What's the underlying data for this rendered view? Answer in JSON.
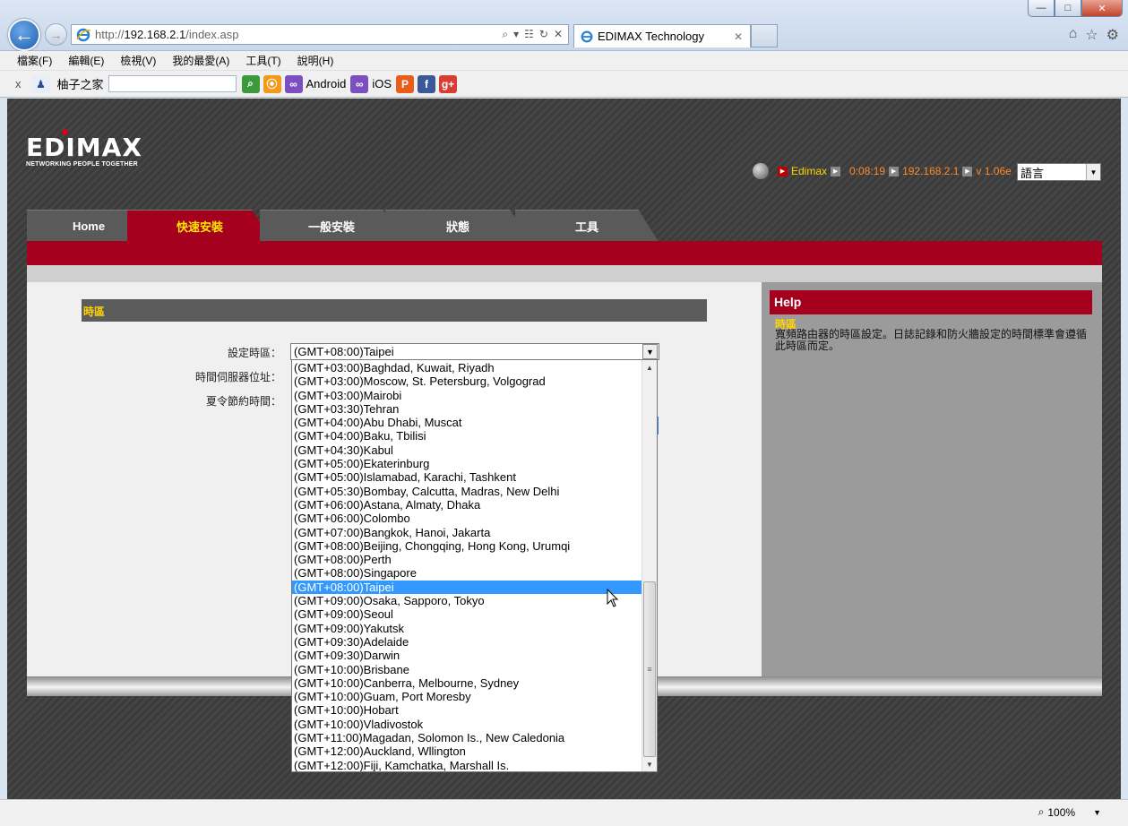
{
  "browser": {
    "url_prefix": "http://",
    "url_host": "192.168.2.1",
    "url_path": "/index.asp",
    "tab_title": "EDIMAX Technology",
    "menu": [
      "檔案(F)",
      "編輯(E)",
      "檢視(V)",
      "我的最愛(A)",
      "工具(T)",
      "說明(H)"
    ],
    "favorites": {
      "site_name": "柚子之家",
      "android_label": "Android",
      "ios_label": "iOS"
    },
    "zoom": "100%"
  },
  "router": {
    "logo": "EDIMAX",
    "logo_tagline": "NETWORKING PEOPLE TOGETHER",
    "status": {
      "name": "Edimax",
      "uptime": "0:08:19",
      "ip": "192.168.2.1",
      "version": "v 1.06e"
    },
    "language_select": "語言",
    "nav_tabs": [
      "Home",
      "快速安裝",
      "一般安裝",
      "狀態",
      "工具"
    ],
    "section_title": "時區",
    "form": {
      "timezone_label": "設定時區：",
      "ntp_label": "時間伺服器位址：",
      "dst_label": "夏令節約時間：",
      "timezone_value": "(GMT+08:00)Taipei"
    },
    "help": {
      "header": "Help",
      "title": "時區",
      "text": "寬頻路由器的時區設定。日誌記錄和防火牆設定的時間標準會遵循此時區而定。"
    },
    "timezone_options": [
      "(GMT+03:00)Baghdad, Kuwait, Riyadh",
      "(GMT+03:00)Moscow, St. Petersburg, Volgograd",
      "(GMT+03:00)Mairobi",
      "(GMT+03:30)Tehran",
      "(GMT+04:00)Abu Dhabi, Muscat",
      "(GMT+04:00)Baku, Tbilisi",
      "(GMT+04:30)Kabul",
      "(GMT+05:00)Ekaterinburg",
      "(GMT+05:00)Islamabad, Karachi, Tashkent",
      "(GMT+05:30)Bombay, Calcutta, Madras, New Delhi",
      "(GMT+06:00)Astana, Almaty, Dhaka",
      "(GMT+06:00)Colombo",
      "(GMT+07:00)Bangkok, Hanoi, Jakarta",
      "(GMT+08:00)Beijing, Chongqing, Hong Kong, Urumqi",
      "(GMT+08:00)Perth",
      "(GMT+08:00)Singapore",
      "(GMT+08:00)Taipei",
      "(GMT+09:00)Osaka, Sapporo, Tokyo",
      "(GMT+09:00)Seoul",
      "(GMT+09:00)Yakutsk",
      "(GMT+09:30)Adelaide",
      "(GMT+09:30)Darwin",
      "(GMT+10:00)Brisbane",
      "(GMT+10:00)Canberra, Melbourne, Sydney",
      "(GMT+10:00)Guam, Port Moresby",
      "(GMT+10:00)Hobart",
      "(GMT+10:00)Vladivostok",
      "(GMT+11:00)Magadan, Solomon Is., New Caledonia",
      "(GMT+12:00)Auckland, Wllington",
      "(GMT+12:00)Fiji, Kamchatka, Marshall Is."
    ],
    "selected_option_index": 16
  }
}
